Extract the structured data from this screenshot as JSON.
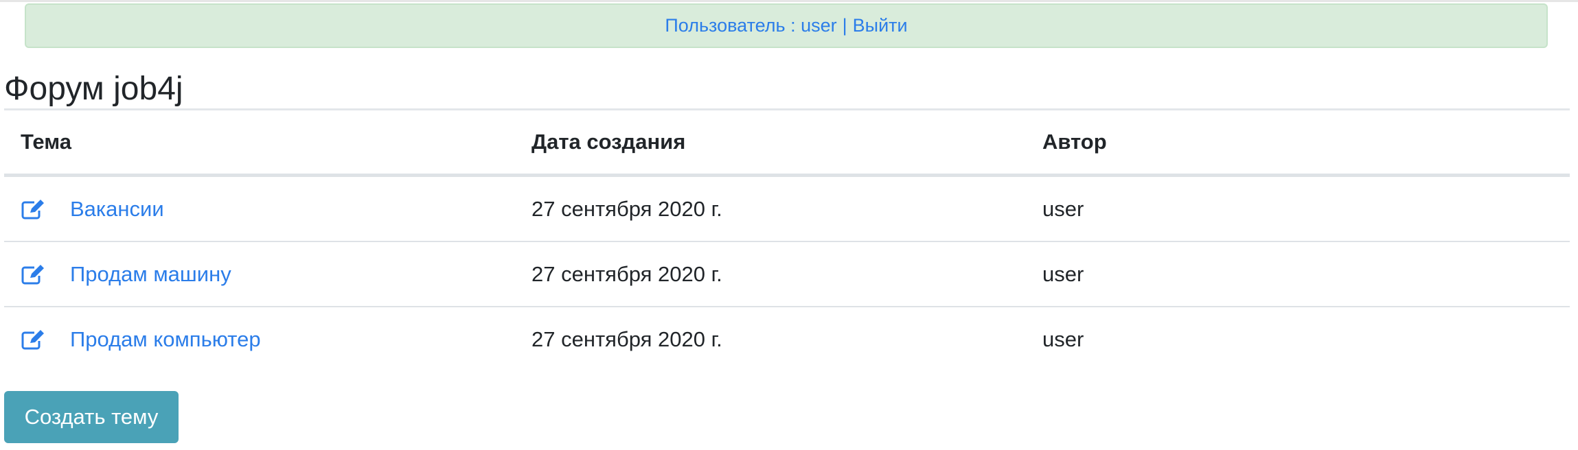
{
  "user_bar": {
    "user_label": "Пользователь : user",
    "separator": "|",
    "logout_label": "Выйти"
  },
  "page_title": "Форум job4j",
  "table": {
    "headers": {
      "topic": "Тема",
      "created": "Дата создания",
      "author": "Автор"
    },
    "rows": [
      {
        "topic": "Вакансии",
        "created": "27 сентября 2020 г.",
        "author": "user",
        "icon": "edit-icon"
      },
      {
        "topic": "Продам машину",
        "created": "27 сентября 2020 г.",
        "author": "user",
        "icon": "edit-icon"
      },
      {
        "topic": "Продам компьютер",
        "created": "27 сентября 2020 г.",
        "author": "user",
        "icon": "edit-icon"
      }
    ]
  },
  "create_button_label": "Создать тему",
  "colors": {
    "link": "#2b7de9",
    "alert_bg": "#d9ecdb",
    "button_bg": "#4aa2b7"
  }
}
